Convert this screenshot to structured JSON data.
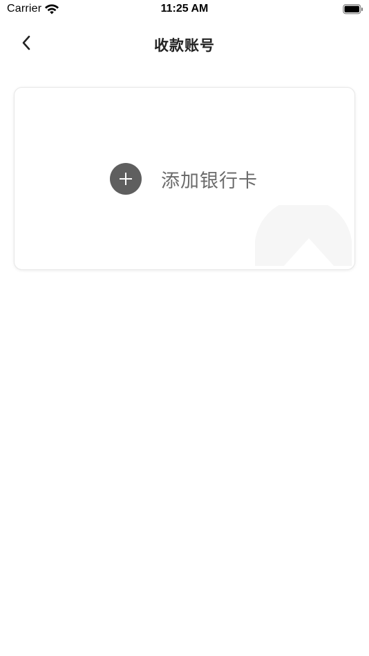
{
  "status_bar": {
    "carrier": "Carrier",
    "time": "11:25 AM",
    "wifi_icon": "wifi-icon",
    "battery_icon": "battery-icon"
  },
  "nav": {
    "title": "收款账号",
    "back_icon": "chevron-left-icon"
  },
  "card": {
    "add_label": "添加银行卡",
    "add_icon": "plus-circle-icon",
    "watermark_icon": "card-watermark-icon"
  },
  "colors": {
    "plus_circle": "#5f5f5f",
    "label": "#6b6b6b",
    "title": "#222222",
    "card_border": "#e7e7e7"
  }
}
